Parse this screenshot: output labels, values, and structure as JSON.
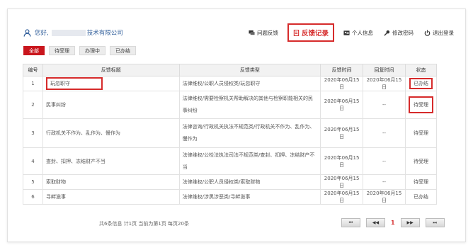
{
  "user": {
    "greeting": "您好,",
    "company_suffix": "技术有限公司"
  },
  "nav": {
    "items": [
      {
        "label": "问题反馈",
        "icon": "chat-icon"
      },
      {
        "label": "反馈记录",
        "icon": "document-icon",
        "active": true
      },
      {
        "label": "个人信息",
        "icon": "id-card-icon"
      },
      {
        "label": "修改密码",
        "icon": "key-icon"
      },
      {
        "label": "退出登录",
        "icon": "power-icon"
      }
    ]
  },
  "filters": [
    "全部",
    "待受理",
    "办理中",
    "已办结"
  ],
  "table": {
    "headers": [
      "编号",
      "反馈标题",
      "反馈类型",
      "反馈时间",
      "回复时间",
      "状态"
    ],
    "rows": [
      {
        "no": "1",
        "title": "玩忽职守",
        "type": "法律维权/公职人员侵权类/玩忽职守",
        "time": "2020年06月15日",
        "reply": "2020年06月15日",
        "status": "已办结"
      },
      {
        "no": "2",
        "title": "民事纠纷",
        "type": "法律维权/需要检察机关帮助解决的其他与检察职能相关的民事纠纷",
        "time": "2020年06月15日",
        "reply": "--",
        "status": "待受理"
      },
      {
        "no": "3",
        "title": "行政机关不作为、乱作为、慢作为",
        "type": "法律咨询/行政机关执法不规范类/行政机关不作为、乱作为、慢作为",
        "time": "2020年06月15日",
        "reply": "--",
        "status": "待受理"
      },
      {
        "no": "4",
        "title": "查封、扣押、冻结财产不当",
        "type": "法律维权/公检法执法司法不规范类/查封、扣押、冻结财产不当",
        "time": "2020年06月15日",
        "reply": "--",
        "status": "待受理"
      },
      {
        "no": "5",
        "title": "索取财物",
        "type": "法律维权/公职人员侵权类/索取财物",
        "time": "2020年06月15日",
        "reply": "--",
        "status": "待受理"
      },
      {
        "no": "6",
        "title": "寻衅滋事",
        "type": "法律维权/涉黑涉恶类/寻衅滋事",
        "time": "2020年06月15日",
        "reply": "2020年06月15日",
        "status": "已办结"
      }
    ]
  },
  "footer": {
    "summary": "共6条信息 计1页 当前为第1页 每页20条",
    "pager": {
      "first": "⏮",
      "prev": "◀◀",
      "current": "1",
      "next": "▶▶",
      "last": "⏭"
    }
  },
  "colors": {
    "accent": "#c9161d",
    "highlight_box": "#d62b2b",
    "user_text": "#2f5d9a"
  }
}
